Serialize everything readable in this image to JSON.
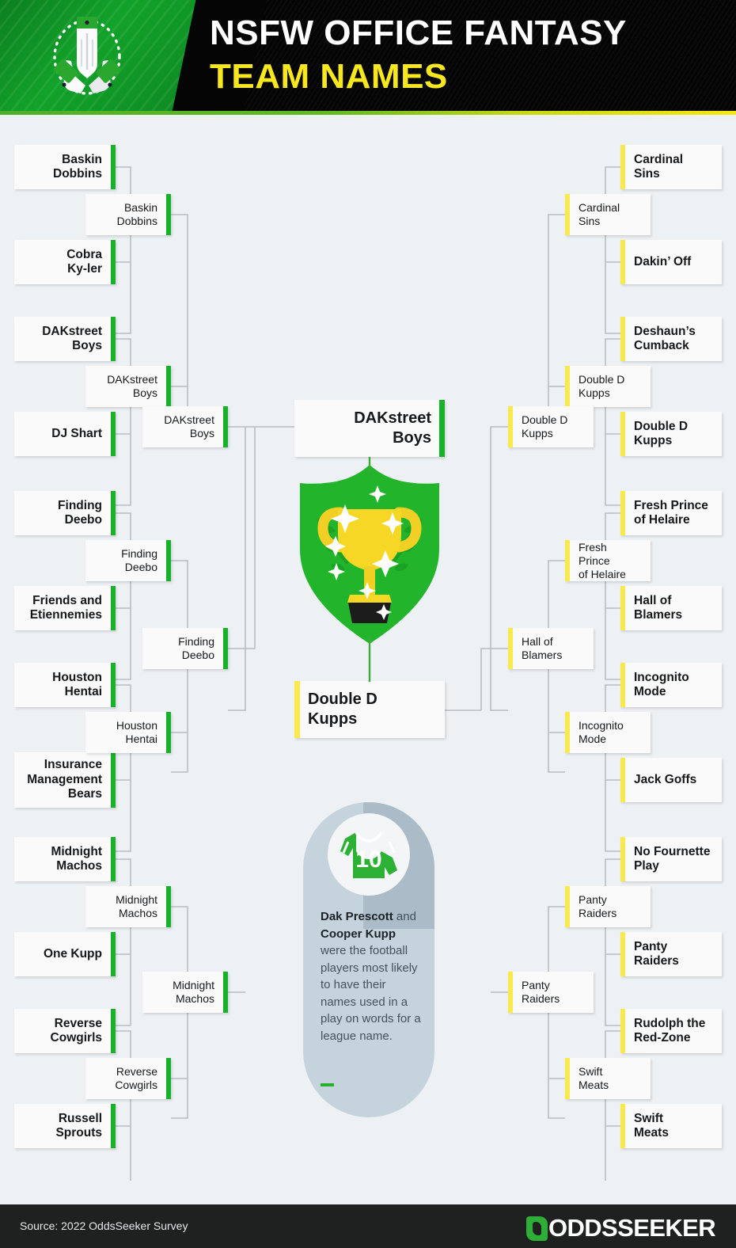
{
  "header": {
    "title_line1": "NSFW OFFICE FANTASY",
    "title_line2": "TEAM NAMES",
    "logo_icon": "praying-hands-icon"
  },
  "colors": {
    "green_accent": "#18b22a",
    "yellow_accent": "#f9e94d",
    "header_black": "#050505",
    "page_bg": "#eef1f4",
    "footer_bg": "#1f2121",
    "trophy_gold": "#f7d726",
    "shield_green": "#22b52c"
  },
  "bracket": {
    "left": {
      "round1": [
        {
          "label": "Baskin\nDobbins"
        },
        {
          "label": "Cobra\nKy-ler"
        },
        {
          "label": "DAKstreet\nBoys"
        },
        {
          "label": "DJ Shart"
        },
        {
          "label": "Finding\nDeebo"
        },
        {
          "label": "Friends and\nEtiennemies"
        },
        {
          "label": "Houston\nHentai"
        },
        {
          "label": "Insurance\nManagement\nBears"
        },
        {
          "label": "Midnight\nMachos"
        },
        {
          "label": "One Kupp"
        },
        {
          "label": "Reverse\nCowgirls"
        },
        {
          "label": "Russell\nSprouts"
        }
      ],
      "round2": [
        {
          "label": "Baskin\nDobbins"
        },
        {
          "label": "DAKstreet\nBoys"
        },
        {
          "label": "Finding\nDeebo"
        },
        {
          "label": "Houston\nHentai"
        },
        {
          "label": "Midnight\nMachos"
        },
        {
          "label": "Reverse\nCowgirls"
        }
      ],
      "round3": [
        {
          "label": "DAKstreet\nBoys"
        },
        {
          "label": "Finding\nDeebo"
        },
        {
          "label": "Midnight\nMachos"
        }
      ]
    },
    "right": {
      "round1": [
        {
          "label": "Cardinal\nSins"
        },
        {
          "label": "Dakin’ Off"
        },
        {
          "label": "Deshaun’s\nCumback"
        },
        {
          "label": "Double D\nKupps"
        },
        {
          "label": "Fresh Prince\nof Helaire"
        },
        {
          "label": "Hall of\nBlamers"
        },
        {
          "label": "Incognito\nMode"
        },
        {
          "label": "Jack Goffs"
        },
        {
          "label": "No Fournette\nPlay"
        },
        {
          "label": "Panty\nRaiders"
        },
        {
          "label": "Rudolph the\nRed-Zone"
        },
        {
          "label": "Swift\nMeats"
        }
      ],
      "round2": [
        {
          "label": "Cardinal\nSins"
        },
        {
          "label": "Double D\nKupps"
        },
        {
          "label": "Fresh Prince\nof Helaire"
        },
        {
          "label": "Incognito\nMode"
        },
        {
          "label": "Panty\nRaiders"
        },
        {
          "label": "Swift\nMeats"
        }
      ],
      "round3": [
        {
          "label": "Double D\nKupps"
        },
        {
          "label": "Hall of\nBlamers"
        },
        {
          "label": "Panty\nRaiders"
        }
      ]
    },
    "finalists": {
      "top": {
        "label": "DAKstreet\nBoys"
      },
      "bottom": {
        "label": "Double D\nKupps"
      }
    }
  },
  "callout": {
    "jersey_number": "10",
    "jersey_icon": "football-jersey-icon",
    "text_plain": "Dak Prescott and Cooper Kupp were the football players most likely to have their names used in a play on words for a league name.",
    "bold_1": "Dak Prescott",
    "mid_1": " and ",
    "bold_2": "Cooper Kupp",
    "rest": " were the football players most likely to have their names used in a play on words for a league name."
  },
  "footer": {
    "source": "Source: 2022 OddsSeeker Survey",
    "brand": "ODDSSEEKER"
  }
}
